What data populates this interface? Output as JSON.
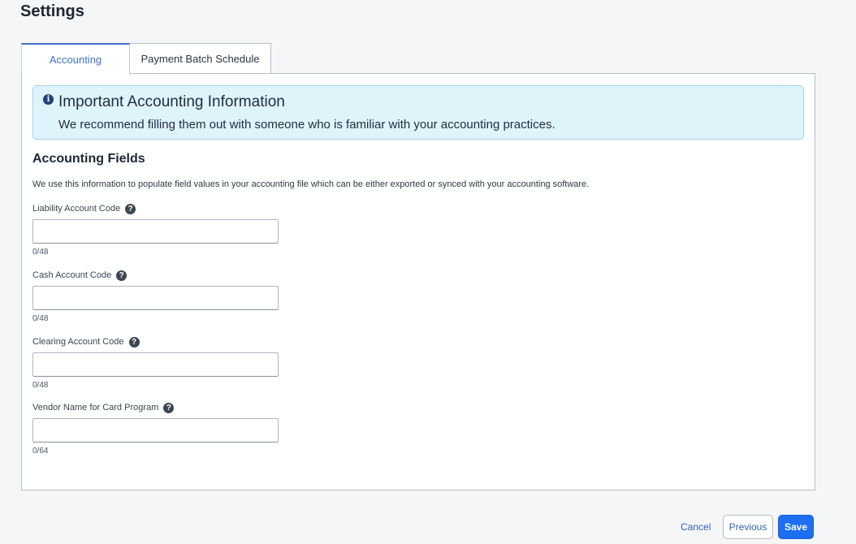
{
  "page": {
    "title": "Settings"
  },
  "tabs": [
    {
      "label": "Accounting",
      "active": true
    },
    {
      "label": "Payment Batch Schedule",
      "active": false
    }
  ],
  "info": {
    "icon": "info-circle-icon",
    "title": "Important Accounting Information",
    "text": "We recommend filling them out with someone who is familiar with your accounting practices."
  },
  "section": {
    "title": "Accounting Fields",
    "description": "We use this information to populate field values in your accounting file which can be either exported or synced with your accounting software."
  },
  "fields": [
    {
      "label": "Liability Account Code",
      "value": "",
      "count": "0/48"
    },
    {
      "label": "Cash Account Code",
      "value": "",
      "count": "0/48"
    },
    {
      "label": "Clearing Account Code",
      "value": "",
      "count": "0/48"
    },
    {
      "label": "Vendor Name for Card Program",
      "value": "",
      "count": "0/64"
    }
  ],
  "help_icon_glyph": "?",
  "info_icon_glyph": "i",
  "actions": {
    "cancel": "Cancel",
    "previous": "Previous",
    "save": "Save"
  },
  "colors": {
    "accent": "#1e6ef3",
    "info_background": "#dff3fb",
    "link": "#2f62b8"
  }
}
